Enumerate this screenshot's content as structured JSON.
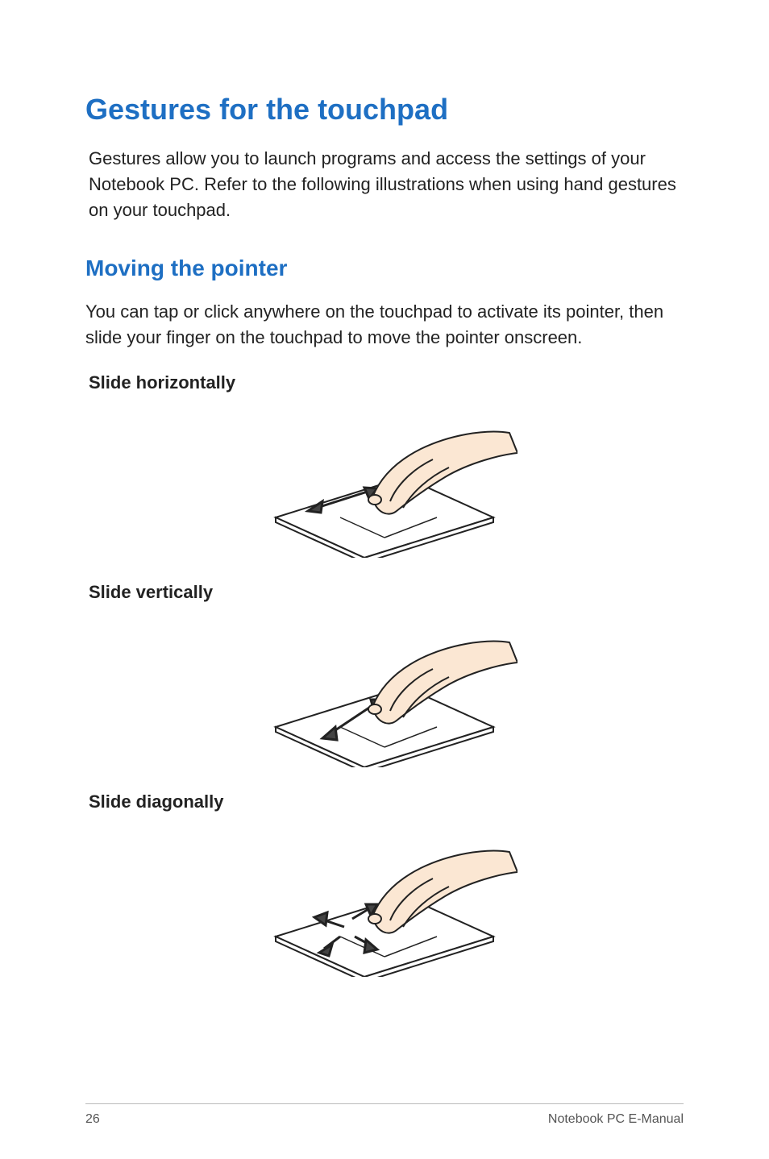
{
  "title": "Gestures for the touchpad",
  "intro": "Gestures allow you to launch programs and access the settings of your Notebook PC. Refer to the following illustrations when using hand gestures on your touchpad.",
  "section": {
    "heading": "Moving the pointer",
    "body": "You can tap or click anywhere on the touchpad to activate its pointer, then slide your finger on the touchpad to move the pointer onscreen.",
    "items": [
      {
        "label": "Slide horizontally"
      },
      {
        "label": "Slide vertically"
      },
      {
        "label": "Slide diagonally"
      }
    ]
  },
  "footer": {
    "page": "26",
    "doc": "Notebook PC E-Manual"
  }
}
